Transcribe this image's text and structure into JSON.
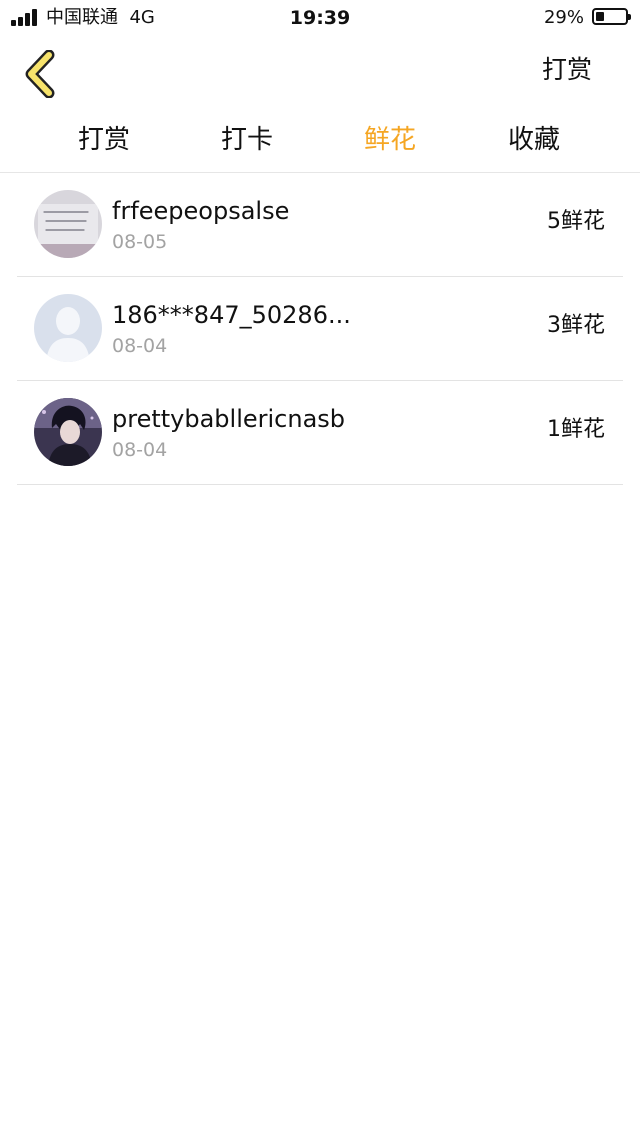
{
  "status_bar": {
    "carrier": "中国联通",
    "network": "4G",
    "time": "19:39",
    "battery": "29%",
    "battery_level": 0.29
  },
  "nav": {
    "back_icon": "chevron-left-icon",
    "action_label": "打赏"
  },
  "tabs": [
    {
      "label": "打赏",
      "active": false
    },
    {
      "label": "打卡",
      "active": false
    },
    {
      "label": "鲜花",
      "active": true
    },
    {
      "label": "收藏",
      "active": false
    }
  ],
  "colors": {
    "accent": "#f5a623",
    "back_icon_fill": "#f7e36b",
    "divider": "#e3e3e3",
    "secondary_text": "#a3a3a3"
  },
  "records": [
    {
      "name": "frfeepeopsalse",
      "date": "08-05",
      "amount": "5鲜花",
      "avatar": "handwriting-note-avatar"
    },
    {
      "name": "186***847_50286...",
      "date": "08-04",
      "amount": "3鲜花",
      "avatar": "default-person-avatar"
    },
    {
      "name": "prettybabllericnasb",
      "date": "08-04",
      "amount": "1鲜花",
      "avatar": "anime-character-avatar"
    }
  ]
}
